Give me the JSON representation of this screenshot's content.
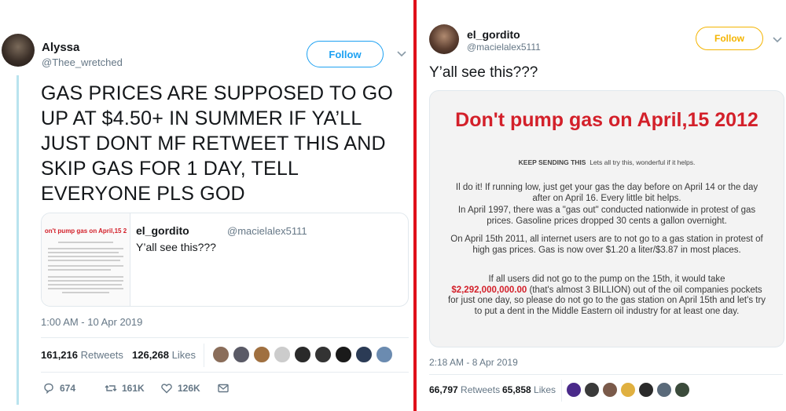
{
  "left_tweet": {
    "author_name": "Alyssa",
    "author_handle": "@Thee_wretched",
    "follow_label": "Follow",
    "text": "GAS PRICES ARE SUPPOSED TO GO UP AT $4.50+ IN SUMMER IF YA’LL JUST DONT MF RETWEET THIS AND SKIP GAS FOR 1 DAY, TELL EVERYONE PLS GOD",
    "quote": {
      "thumb_title": "on't pump gas on April,15 2",
      "author_name": "el_gordito",
      "author_handle": "@macielalex5111",
      "text": "Y’all see this???"
    },
    "timestamp": "1:00 AM - 10 Apr 2019",
    "retweets_count": "161,216",
    "retweets_label": "Retweets",
    "likes_count": "126,268",
    "likes_label": "Likes",
    "actions": {
      "reply_count": "674",
      "retweet_count": "161K",
      "like_count": "126K"
    }
  },
  "right_tweet": {
    "author_name": "el_gordito",
    "author_handle": "@macielalex5111",
    "follow_label": "Follow",
    "text": "Y’all see this???",
    "flyer": {
      "title": "Don't pump gas on April,15 2012",
      "subtitle_bold": "KEEP SENDING THIS",
      "subtitle_rest": "Lets all try this, wonderful if it helps.",
      "p1": "Il do it! If running low, just get your gas the day before on April 14 or the day after on April 16. Every little bit helps.",
      "p2": "In April 1997, there was a \"gas out\" conducted nationwide in protest of gas prices. Gasoline prices dropped 30 cents a gallon overnight.",
      "p3": "On April 15th 2011, all internet users are to not go to a gas station in protest of high gas prices. Gas is now over $1.20 a liter/$3.87 in most places.",
      "p4_a": "If all users did not go to the pump on the 15th, it would take",
      "p4_money": "$2,292,000,000.00",
      "p4_b": "(that's almost 3 BILLION) out of the oil companies pockets for just one day, so please do not go to the gas station on April 15th and let's try to put a dent in the Middle Eastern oil industry for at least one day."
    },
    "timestamp": "2:18 AM - 8 Apr 2019",
    "retweets_count": "66,797",
    "retweets_label": "Retweets",
    "likes_count": "65,858",
    "likes_label": "Likes"
  },
  "colors": {
    "accent_blue": "#1da1f2",
    "divider_red": "#e0101a",
    "flyer_red": "#d3202a"
  }
}
